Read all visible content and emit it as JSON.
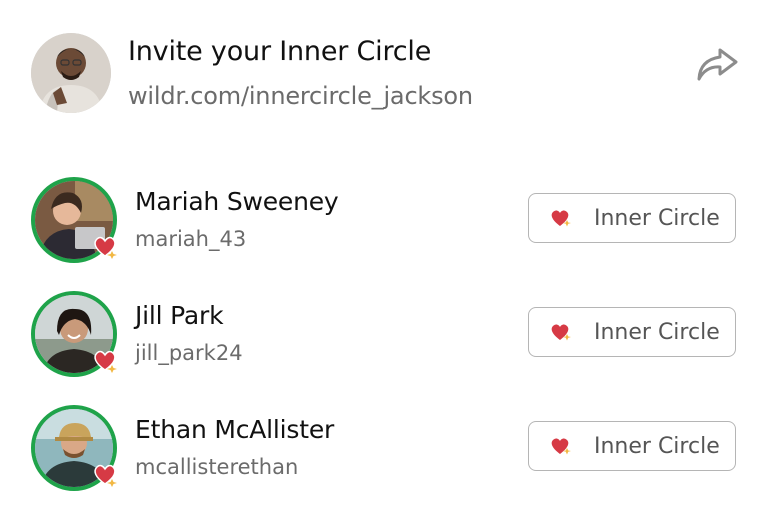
{
  "header": {
    "avatar_icon": "user-avatar",
    "title": "Invite your Inner Circle",
    "link": "wildr.com/innercircle_jackson",
    "share_icon": "share-arrow-icon"
  },
  "members": [
    {
      "name": "Mariah Sweeney",
      "handle": "mariah_43",
      "button_label": "Inner Circle",
      "badge_icon": "heart-sparkle-icon"
    },
    {
      "name": "Jill Park",
      "handle": "jill_park24",
      "button_label": "Inner Circle",
      "badge_icon": "heart-sparkle-icon"
    },
    {
      "name": "Ethan McAllister",
      "handle": "mcallisterethan",
      "button_label": "Inner Circle",
      "badge_icon": "heart-sparkle-icon"
    }
  ],
  "colors": {
    "ring_green": "#1fa34a",
    "heart_red": "#d63a45",
    "sparkle_gold": "#f2b844",
    "muted_text": "#6b6b6b",
    "button_border": "#b5b5b5"
  }
}
